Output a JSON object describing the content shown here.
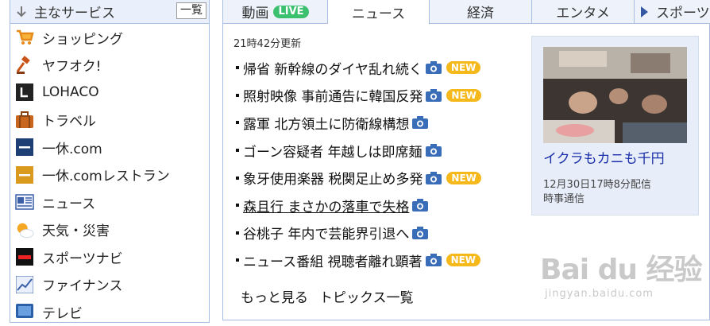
{
  "sidebar": {
    "title": "主なサービス",
    "list_button": "一覧",
    "items": [
      {
        "label": "ショッピング",
        "icon": "shopping-cart-icon"
      },
      {
        "label": "ヤフオク!",
        "icon": "auction-hammer-icon"
      },
      {
        "label": "LOHACO",
        "icon": "lohaco-icon"
      },
      {
        "label": "トラベル",
        "icon": "suitcase-icon"
      },
      {
        "label": "一休.com",
        "icon": "ikyu-icon"
      },
      {
        "label": "一休.comレストラン",
        "icon": "ikyu-restaurant-icon"
      },
      {
        "label": "ニュース",
        "icon": "news-icon"
      },
      {
        "label": "天気・災害",
        "icon": "weather-icon"
      },
      {
        "label": "スポーツナビ",
        "icon": "sportsnavi-icon"
      },
      {
        "label": "ファイナンス",
        "icon": "finance-chart-icon"
      },
      {
        "label": "テレビ",
        "icon": "tv-icon"
      }
    ]
  },
  "tabs": [
    {
      "label": "動画",
      "badge": "LIVE"
    },
    {
      "label": "ニュース",
      "active": true
    },
    {
      "label": "経済"
    },
    {
      "label": "エンタメ"
    },
    {
      "label": "スポーツ"
    }
  ],
  "news": {
    "updated": "21時42分更新",
    "items": [
      {
        "title": "帰省 新幹線のダイヤ乱れ続く",
        "new": true
      },
      {
        "title": "照射映像 事前通告に韓国反発",
        "new": true
      },
      {
        "title": "露軍 北方領土に防衛線構想",
        "new": false
      },
      {
        "title": "ゴーン容疑者 年越しは即席麺",
        "new": false
      },
      {
        "title": "象牙使用楽器 税関足止め多発",
        "new": true
      },
      {
        "title": "森且行 まさかの落車で失格",
        "new": false,
        "link": true
      },
      {
        "title": "谷桃子 年内で芸能界引退へ",
        "new": false
      },
      {
        "title": "ニュース番組 視聴者離れ顕著",
        "new": true
      }
    ],
    "new_label": "NEW",
    "more": "もっと見る",
    "topics": "トピックス一覧"
  },
  "feature": {
    "title": "イクラもカニも千円",
    "date": "12月30日17時8分配信",
    "source": "時事通信"
  },
  "watermark": {
    "main": "Bai du 经验",
    "sub": "jingyan.baidu.com"
  },
  "colors": {
    "accent": "#3558a5",
    "live": "#3bc070",
    "new": "#f6b91c",
    "feature_link": "#1a2fa8"
  }
}
